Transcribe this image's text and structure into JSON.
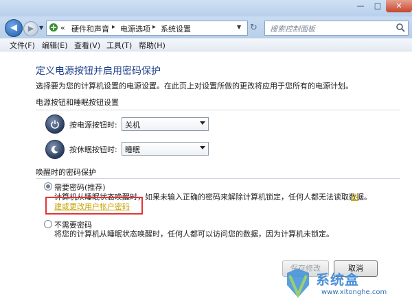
{
  "window": {
    "controls": {
      "minimize": "—",
      "maximize": "□",
      "close": "✕"
    }
  },
  "nav": {
    "back_glyph": "◀",
    "forward_glyph": "▶",
    "address_prefix": "«",
    "breadcrumbs": [
      "硬件和声音",
      "电源选项",
      "系统设置"
    ],
    "breadcrumb_sep": "▸",
    "search_placeholder": "搜索控制面板"
  },
  "menu": [
    "文件(F)",
    "编辑(E)",
    "查看(V)",
    "工具(T)",
    "帮助(H)"
  ],
  "page": {
    "title": "定义电源按钮并启用密码保护",
    "description": "选择要为您的计算机设置的电源设置。在此页上对设置所做的更改将应用于您所有的电源计划。"
  },
  "power_section": {
    "title": "电源按钮和睡眠按钮设置",
    "rows": [
      {
        "label": "按电源按钮时:",
        "value": "关机",
        "icon": "power-button-icon"
      },
      {
        "label": "按休眠按钮时:",
        "value": "睡眠",
        "icon": "sleep-button-icon"
      }
    ]
  },
  "password_section": {
    "title": "唤醒时的密码保护",
    "option1": {
      "label": "需要密码(推荐)",
      "desc": "计算机从睡眠状态唤醒时，如果未输入正确的密码来解除计算机锁定，任何人都无法读取数据。",
      "link_part1": "创",
      "link_part2": "建或更改用户帐户密码",
      "selected": true
    },
    "option2": {
      "label": "不需要密码",
      "desc": "将您的计算机从睡眠状态唤醒时，任何人都可以访问您的数据，因为计算机未锁定。",
      "selected": false
    }
  },
  "buttons": {
    "save": "保存修改",
    "cancel": "取消"
  },
  "watermark": {
    "brand": "系统盒",
    "url": "www.xitonghe.com"
  },
  "colors": {
    "title_blue": "#1e3f8a",
    "link_yellow": "#c6a400",
    "highlight_red": "#e23434"
  }
}
